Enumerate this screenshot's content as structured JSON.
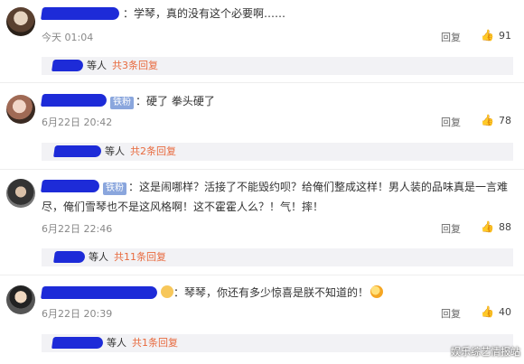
{
  "comments": [
    {
      "text": "：学琴，真的没有这个必要啊……",
      "time": "今天 01:04",
      "reply_label": "回复",
      "likes": "91",
      "sub_who": "等人",
      "sub_count": "共3条回复"
    },
    {
      "badge": "铁粉",
      "text": "：硬了 拳头硬了",
      "time": "6月22日 20:42",
      "reply_label": "回复",
      "likes": "78",
      "sub_who": "等人",
      "sub_count": "共2条回复"
    },
    {
      "badge": "铁粉",
      "text_line1": "：这是闹哪样？活接了不能毁约呗？给俺们整成这样！男人装的品味真是一言难",
      "text_line2": "尽，俺们雪琴也不是这风格啊！这不霍霍人么？！气！摔！",
      "time": "6月22日 22:46",
      "reply_label": "回复",
      "likes": "88",
      "sub_who": "等人",
      "sub_count": "共11条回复"
    },
    {
      "text": "：琴琴，你还有多少惊喜是朕不知道的！",
      "time": "6月22日 20:39",
      "reply_label": "回复",
      "likes": "40",
      "sub_who": "等人",
      "sub_count": "共1条回复"
    }
  ],
  "watermark": "娱乐综艺情报站",
  "colors": {
    "redaction": "#1d2bd8",
    "count_link": "#e86a3e",
    "badge": "#8aa6dd"
  },
  "icons": {
    "like": "thumbs-up-icon"
  }
}
